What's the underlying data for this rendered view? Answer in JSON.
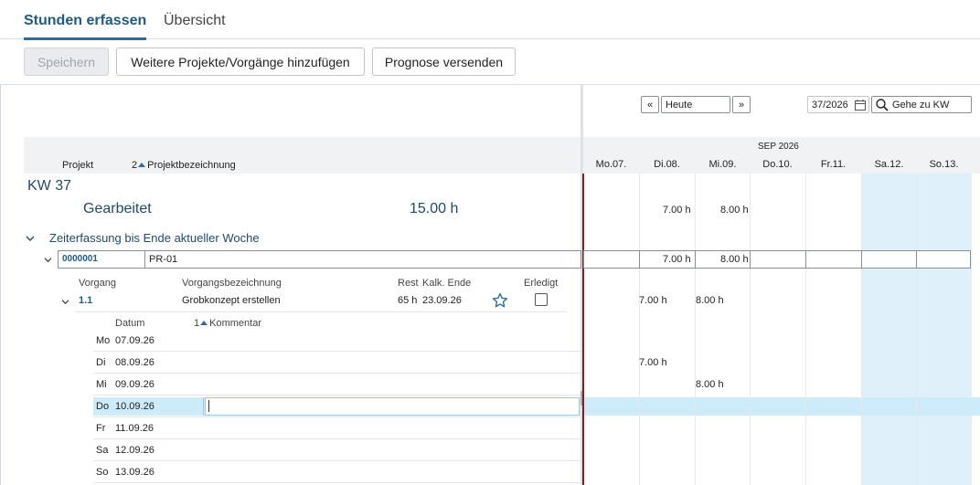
{
  "tabs": [
    {
      "label": "Stunden erfassen"
    },
    {
      "label": "Übersicht"
    }
  ],
  "toolbar": {
    "save_label": "Speichern",
    "add_label": "Weitere Projekte/Vorgänge hinzufügen",
    "forecast_label": "Prognose versenden"
  },
  "nav": {
    "prev": "«",
    "today": "Heute",
    "next": "»",
    "week_value": "37/2026",
    "goto_label": "Gehe zu KW"
  },
  "headers": {
    "project": "Projekt",
    "sort_index": "2",
    "project_name": "Projektbezeichnung",
    "month": "SEP 2026",
    "days": [
      "Mo.07.",
      "Di.08.",
      "Mi.09.",
      "Do.10.",
      "Fr.11.",
      "Sa.12.",
      "So.13."
    ]
  },
  "week": {
    "label": "KW 37",
    "worked_label": "Gearbeitet",
    "worked_total": "15.00 h",
    "tue_total": "7.00 h",
    "wed_total": "8.00 h"
  },
  "group": {
    "title": "Zeiterfassung bis Ende aktueller Woche"
  },
  "project": {
    "number": "0000001",
    "name": "PR-01",
    "tue": "7.00 h",
    "wed": "8.00 h"
  },
  "task_headers": {
    "task": "Vorgang",
    "task_name": "Vorgangsbezeichnung",
    "rest": "Rest",
    "calc_end": "Kalk. Ende",
    "done": "Erledigt"
  },
  "task": {
    "id": "1.1",
    "name": "Grobkonzept erstellen",
    "rest": "65 h",
    "end": "23.09.26",
    "tue": "7.00 h",
    "wed": "8.00 h"
  },
  "detail_headers": {
    "date": "Datum",
    "sort_index": "1",
    "comment": "Kommentar"
  },
  "days": [
    {
      "wd": "Mo",
      "date": "07.09.26",
      "hours": ""
    },
    {
      "wd": "Di",
      "date": "08.09.26",
      "hours": "7.00 h"
    },
    {
      "wd": "Mi",
      "date": "09.09.26",
      "hours": "8.00 h"
    },
    {
      "wd": "Do",
      "date": "10.09.26",
      "hours": ""
    },
    {
      "wd": "Fr",
      "date": "11.09.26",
      "hours": ""
    },
    {
      "wd": "Sa",
      "date": "12.09.26",
      "hours": ""
    },
    {
      "wd": "So",
      "date": "13.09.26",
      "hours": ""
    }
  ],
  "colors": {
    "accent": "#2b6ca3",
    "weekend": "#e0f0fb",
    "selected_row": "#cdebf8",
    "today_line": "#8b1a1a"
  }
}
